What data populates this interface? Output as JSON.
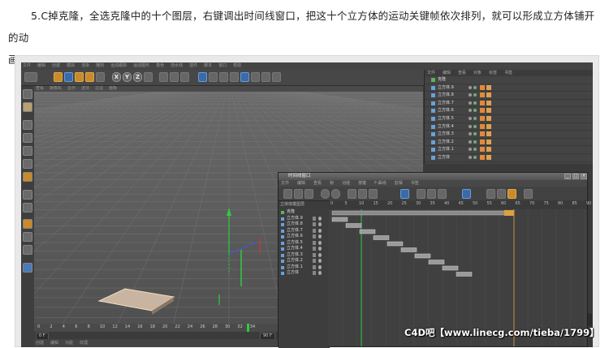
{
  "article": {
    "line1": "5.C掉克隆，全选克隆中的十个图层，右键调出时间线窗口，把这十个立方体的运动关键帧依次排列，就可以形成立方体铺开的动",
    "line2": "画了。"
  },
  "watermark": "C4D吧【www.linecg.com/tieba/1799】",
  "c4d": {
    "menu_items": [
      "文件",
      "编辑",
      "创建",
      "模拟",
      "渲染",
      "雕刻",
      "运动跟踪",
      "运动图形",
      "角色",
      "流水线",
      "插件",
      "脚本",
      "窗口",
      "帮助"
    ],
    "viewport_menu": [
      "查看",
      "摄像机",
      "显示",
      "选项",
      "过滤",
      "面板"
    ],
    "ruler_numbers": [
      "0",
      "2",
      "4",
      "6",
      "8",
      "10",
      "12",
      "14",
      "16",
      "18",
      "20",
      "22",
      "24",
      "26",
      "28",
      "30",
      "32",
      "34"
    ],
    "frame_start": "0 F",
    "frame_end": "90 F",
    "bottom_tabs": [
      "创建",
      "编辑",
      "功能",
      "纹理"
    ],
    "object_manager": {
      "header": [
        "文件",
        "编辑",
        "查看",
        "对象",
        "标签",
        "书签"
      ],
      "root": "克隆",
      "rows": [
        "立方体.9",
        "立方体.8",
        "立方体.7",
        "立方体.6",
        "立方体.5",
        "立方体.4",
        "立方体.3",
        "立方体.2",
        "立方体.1",
        "立方体"
      ]
    },
    "timeline": {
      "title": "时间线窗口",
      "menu": [
        "文件",
        "编辑",
        "查看",
        "帧",
        "功能",
        "按键",
        "F-曲线",
        "剪辑",
        "书签"
      ],
      "layer_header": "立体体模型层",
      "root": "克隆",
      "layers": [
        "立方体.9",
        "立方体.8",
        "立方体.7",
        "立方体.6",
        "立方体.5",
        "立方体.4",
        "立方体.3",
        "立方体.2",
        "立方体.1",
        "立方体"
      ],
      "ruler": [
        "0",
        "5",
        "10",
        "15",
        "20",
        "25",
        "30",
        "35",
        "40",
        "45",
        "50",
        "55",
        "60",
        "65",
        "70",
        "75",
        "80",
        "85",
        "90"
      ],
      "key_offsets": [
        0,
        1,
        2,
        3,
        4,
        5,
        6,
        7,
        8,
        9
      ]
    }
  },
  "colors": {
    "ui_bg": "#3a3a3a",
    "viewport_bg": "#5a5a5a",
    "key_grey": "#9a9a9a",
    "accent_orange": "#e0a040",
    "axis_green": "#2ecc40",
    "axis_blue": "#3b5bdb",
    "axis_red": "#e03030"
  }
}
